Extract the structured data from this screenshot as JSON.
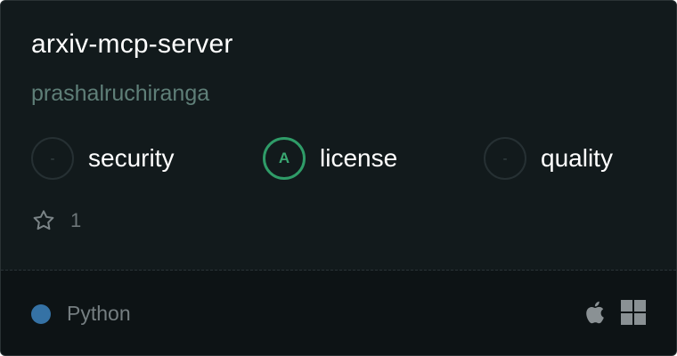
{
  "server": {
    "name": "arxiv-mcp-server",
    "author": "prashalruchiranga"
  },
  "scores": [
    {
      "grade": "-",
      "label": "security"
    },
    {
      "grade": "A",
      "label": "license"
    },
    {
      "grade": "-",
      "label": "quality"
    }
  ],
  "stars": {
    "icon": "star-icon",
    "count": "1"
  },
  "footer": {
    "language": "Python",
    "language_color": "#3572a5",
    "platforms": [
      "apple-icon",
      "windows-icon"
    ]
  },
  "colors": {
    "background": "#121a1c",
    "footer_background": "#0d1315",
    "grade_a": "#2f9c68",
    "author": "#5f7f78"
  }
}
